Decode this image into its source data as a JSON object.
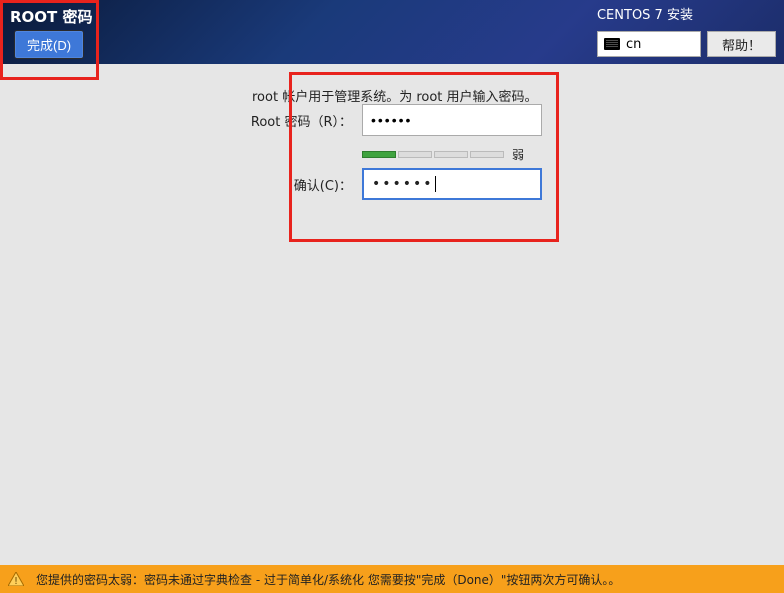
{
  "header": {
    "title": "ROOT 密码",
    "done_label": "完成(D)",
    "install_title": "CENTOS 7 安装",
    "lang_code": "cn",
    "help_label": "帮助！"
  },
  "form": {
    "instruction": "root 帐户用于管理系统。为 root 用户输入密码。",
    "password_label": "Root 密码（R）：",
    "password_value": "••••••",
    "strength_label": "弱",
    "confirm_label": "确认(C)：",
    "confirm_value": "••••••"
  },
  "warning": {
    "text": "您提供的密码太弱：密码未通过字典检查 - 过于简单化/系统化 您需要按\"完成（Done）\"按钮两次方可确认。。"
  }
}
